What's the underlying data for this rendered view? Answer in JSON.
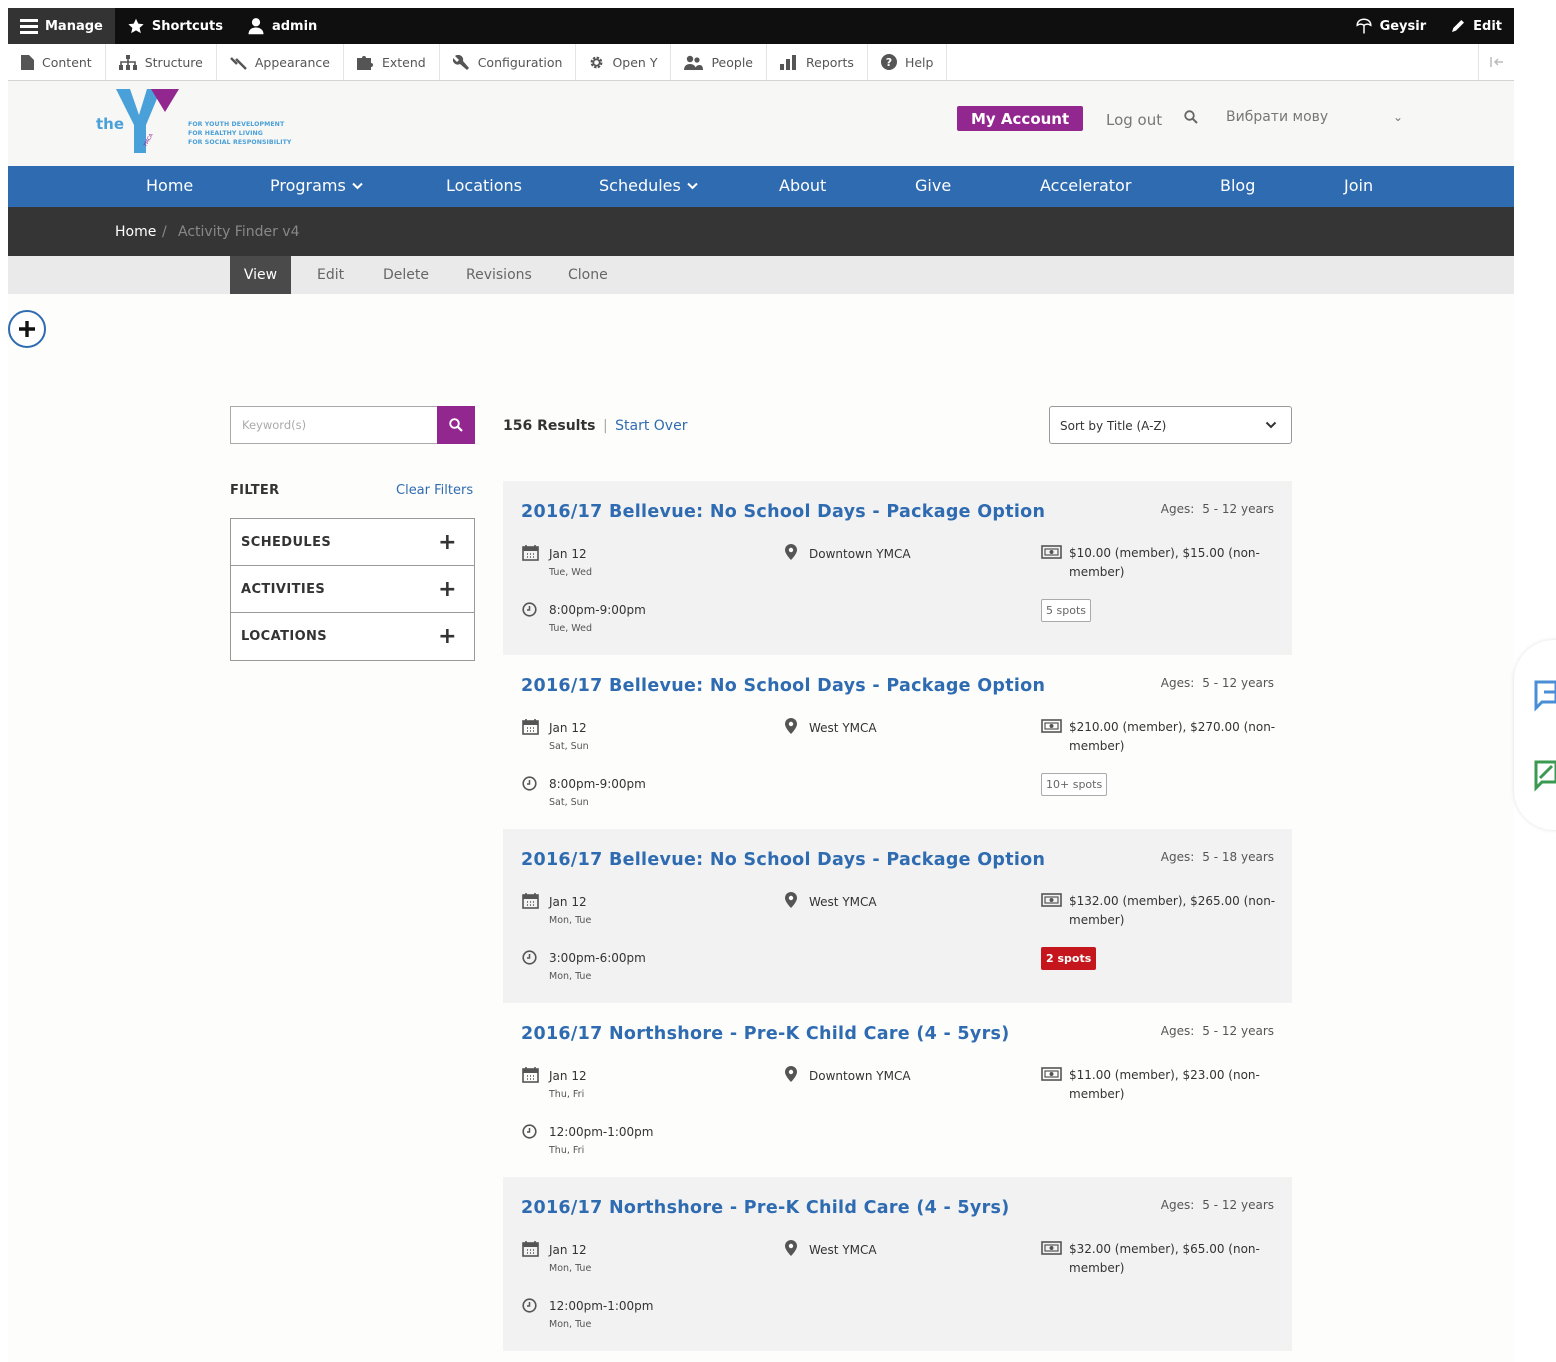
{
  "toolbar": {
    "manage": "Manage",
    "shortcuts": "Shortcuts",
    "user": "admin",
    "site_name": "Geysir",
    "edit": "Edit"
  },
  "admin_menu": [
    {
      "label": "Content",
      "icon": "file-icon"
    },
    {
      "label": "Structure",
      "icon": "sitemap-icon"
    },
    {
      "label": "Appearance",
      "icon": "brush-icon"
    },
    {
      "label": "Extend",
      "icon": "puzzle-icon"
    },
    {
      "label": "Configuration",
      "icon": "wrench-icon"
    },
    {
      "label": "Open Y",
      "icon": "gear-icon"
    },
    {
      "label": "People",
      "icon": "people-icon"
    },
    {
      "label": "Reports",
      "icon": "bar-chart-icon"
    },
    {
      "label": "Help",
      "icon": "help-icon"
    }
  ],
  "header": {
    "logo_word": "the",
    "logo_small": "YMCA",
    "logo_lines": [
      "FOR YOUTH DEVELOPMENT",
      "FOR HEALTHY LIVING",
      "FOR SOCIAL RESPONSIBILITY"
    ],
    "account": "My Account",
    "logout": "Log out",
    "language": "Вибрати мову"
  },
  "nav": [
    "Home",
    "Programs",
    "Locations",
    "Schedules",
    "About",
    "Give",
    "Accelerator",
    "Blog",
    "Join"
  ],
  "breadcrumb": {
    "home": "Home",
    "separator": "/",
    "current": "Activity Finder v4"
  },
  "tabs": [
    "View",
    "Edit",
    "Delete",
    "Revisions",
    "Clone"
  ],
  "search": {
    "placeholder": "Keyword(s)"
  },
  "filters": {
    "title": "FILTER",
    "clear": "Clear Filters",
    "groups": [
      "SCHEDULES",
      "ACTIVITIES",
      "LOCATIONS"
    ]
  },
  "results": {
    "count": "156 Results",
    "separator": "|",
    "start_over": "Start Over"
  },
  "sort": {
    "selected": "Sort by Title (A-Z)"
  },
  "ages_label": "Ages:",
  "items": [
    {
      "title": "2016/17 Bellevue: No School Days - Package Option",
      "ages": "5 - 12 years",
      "date": "Jan 12",
      "date_days": "Tue, Wed",
      "time": "8:00pm-9:00pm",
      "time_days": "Tue, Wed",
      "location": "Downtown YMCA",
      "price_1": "$10.00 (member), $15.00 (non-",
      "price_2": "member)",
      "spots": "5 spots",
      "spots_alert": false
    },
    {
      "title": "2016/17 Bellevue: No School Days - Package Option",
      "ages": "5 - 12 years",
      "date": "Jan 12",
      "date_days": "Sat, Sun",
      "time": "8:00pm-9:00pm",
      "time_days": "Sat, Sun",
      "location": "West YMCA",
      "price_1": "$210.00 (member), $270.00 (non-",
      "price_2": "member)",
      "spots": "10+ spots",
      "spots_alert": false
    },
    {
      "title": "2016/17 Bellevue: No School Days - Package Option",
      "ages": "5 - 18 years",
      "date": "Jan 12",
      "date_days": "Mon, Tue",
      "time": "3:00pm-6:00pm",
      "time_days": "Mon, Tue",
      "location": "West YMCA",
      "price_1": "$132.00 (member), $265.00 (non-",
      "price_2": "member)",
      "spots": "2 spots",
      "spots_alert": true
    },
    {
      "title": "2016/17 Northshore - Pre-K Child Care (4 - 5yrs)",
      "ages": "5 - 12 years",
      "date": "Jan 12",
      "date_days": "Thu, Fri",
      "time": "12:00pm-1:00pm",
      "time_days": "Thu, Fri",
      "location": "Downtown YMCA",
      "price_1": "$11.00 (member), $23.00 (non-",
      "price_2": "member)",
      "spots": "",
      "spots_alert": false
    },
    {
      "title": "2016/17 Northshore - Pre-K Child Care (4 - 5yrs)",
      "ages": "5 - 12 years",
      "date": "Jan 12",
      "date_days": "Mon, Tue",
      "time": "12:00pm-1:00pm",
      "time_days": "Mon, Tue",
      "location": "West YMCA",
      "price_1": "$32.00 (member), $65.00 (non-",
      "price_2": "member)",
      "spots": "",
      "spots_alert": false
    }
  ],
  "colors": {
    "brand_purple": "#92278f",
    "nav_blue": "#2f6bb1",
    "alert_red": "#c5161d",
    "logo_blue": "#4aa0d8"
  }
}
